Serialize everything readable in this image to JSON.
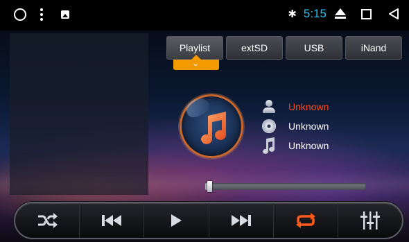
{
  "status_bar": {
    "time": "5:15",
    "bluetooth_icon": "bluetooth-icon",
    "icons_left": [
      "circle-icon",
      "menu-dots-icon",
      "image-icon"
    ],
    "icons_right": [
      "eject-icon",
      "recents-square-icon",
      "back-triangle-icon"
    ],
    "time_color": "#27c4f2"
  },
  "tabs": [
    {
      "label": "Playlist",
      "active": true
    },
    {
      "label": "extSD",
      "active": false
    },
    {
      "label": "USB",
      "active": false
    },
    {
      "label": "iNand",
      "active": false
    }
  ],
  "track": {
    "artist": "Unknown",
    "album": "Unknown",
    "title": "Unknown",
    "artist_color": "#ff4a1c",
    "text_color": "#ffffff"
  },
  "progress": {
    "fraction": 0.02
  },
  "controls": [
    "shuffle-icon",
    "previous-track-icon",
    "play-icon",
    "next-track-icon",
    "repeat-icon",
    "equalizer-icon"
  ],
  "accent_color": "#f29a00",
  "repeat_color": "#ff5a1c"
}
